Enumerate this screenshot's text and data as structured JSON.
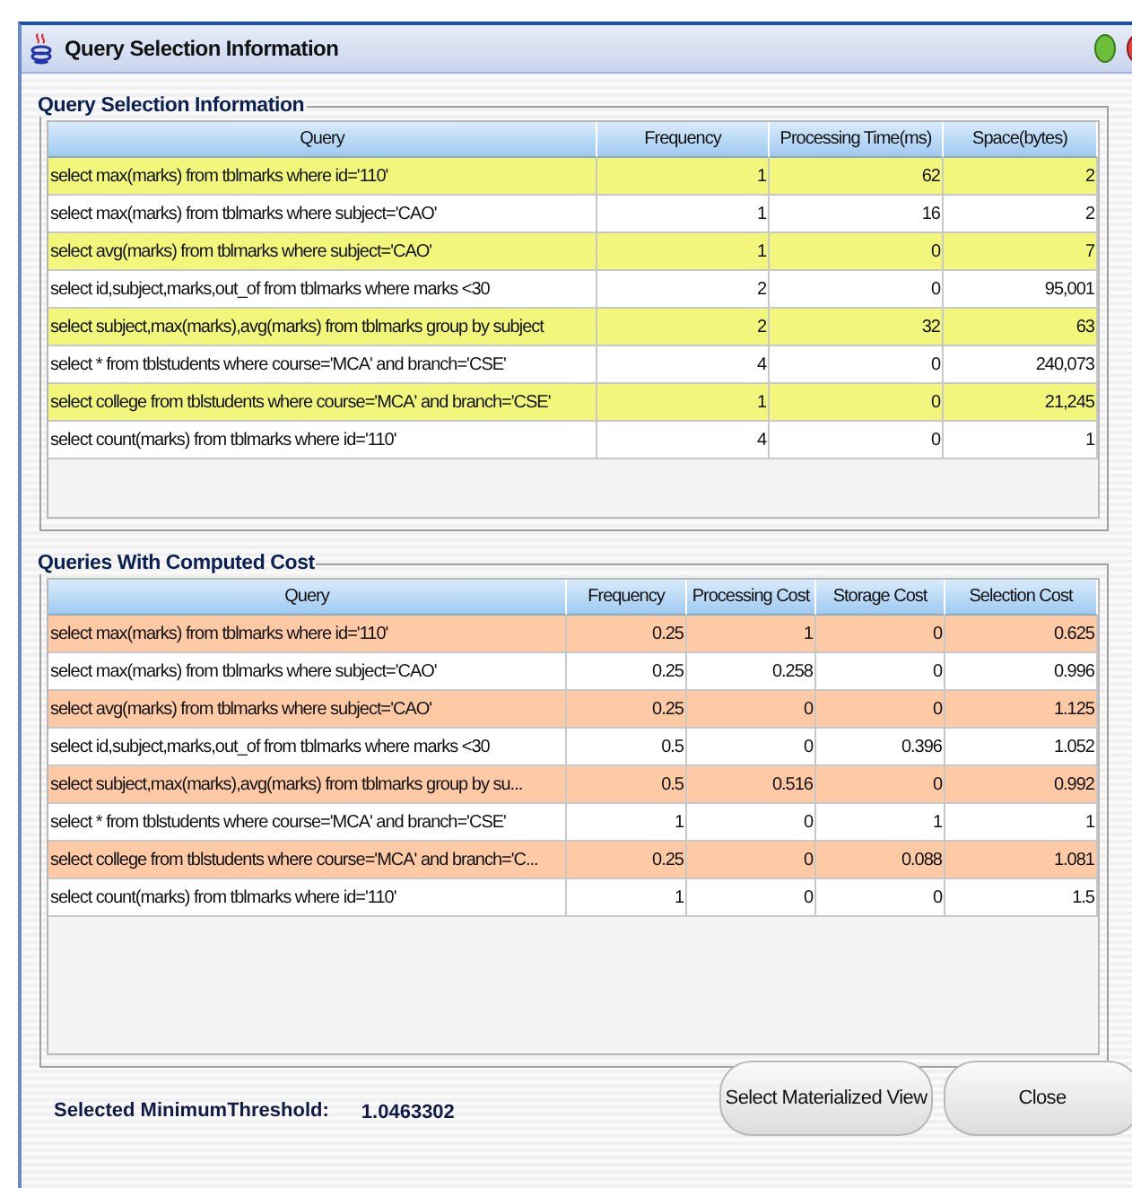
{
  "window": {
    "title": "Query Selection Information"
  },
  "selection_table": {
    "title": "Query Selection Information",
    "columns": [
      "Query",
      "Frequency",
      "Processing Time(ms)",
      "Space(bytes)"
    ],
    "rows": [
      {
        "highlighted": true,
        "cells": [
          "select max(marks) from tblmarks where id='110'",
          "1",
          "62",
          "2"
        ]
      },
      {
        "highlighted": false,
        "cells": [
          "select max(marks) from tblmarks where subject='CAO'",
          "1",
          "16",
          "2"
        ]
      },
      {
        "highlighted": true,
        "cells": [
          "select avg(marks) from tblmarks where subject='CAO'",
          "1",
          "0",
          "7"
        ]
      },
      {
        "highlighted": false,
        "cells": [
          "select id,subject,marks,out_of from tblmarks where marks <30",
          "2",
          "0",
          "95,001"
        ]
      },
      {
        "highlighted": true,
        "cells": [
          "select subject,max(marks),avg(marks) from tblmarks  group by subject",
          "2",
          "32",
          "63"
        ]
      },
      {
        "highlighted": false,
        "cells": [
          "select * from tblstudents where course='MCA' and branch='CSE'",
          "4",
          "0",
          "240,073"
        ]
      },
      {
        "highlighted": true,
        "cells": [
          "select college from tblstudents where course='MCA' and branch='CSE'",
          "1",
          "0",
          "21,245"
        ]
      },
      {
        "highlighted": false,
        "cells": [
          "select count(marks) from tblmarks where id='110'",
          "4",
          "0",
          "1"
        ]
      }
    ]
  },
  "cost_table": {
    "title": "Queries With Computed Cost",
    "columns": [
      "Query",
      "Frequency",
      "Processing Cost",
      "Storage Cost",
      "Selection Cost"
    ],
    "rows": [
      {
        "highlighted": true,
        "cells": [
          "select max(marks) from tblmarks where id='110'",
          "0.25",
          "1",
          "0",
          "0.625"
        ]
      },
      {
        "highlighted": false,
        "cells": [
          "select max(marks) from tblmarks where subject='CAO'",
          "0.25",
          "0.258",
          "0",
          "0.996"
        ]
      },
      {
        "highlighted": true,
        "cells": [
          "select avg(marks) from tblmarks where subject='CAO'",
          "0.25",
          "0",
          "0",
          "1.125"
        ]
      },
      {
        "highlighted": false,
        "cells": [
          "select id,subject,marks,out_of from tblmarks where marks <30",
          "0.5",
          "0",
          "0.396",
          "1.052"
        ]
      },
      {
        "highlighted": true,
        "cells": [
          "select subject,max(marks),avg(marks) from tblmarks  group by su...",
          "0.5",
          "0.516",
          "0",
          "0.992"
        ]
      },
      {
        "highlighted": false,
        "cells": [
          "select * from tblstudents where course='MCA' and branch='CSE'",
          "1",
          "0",
          "1",
          "1"
        ]
      },
      {
        "highlighted": true,
        "cells": [
          "select college from tblstudents where course='MCA' and branch='C...",
          "0.25",
          "0",
          "0.088",
          "1.081"
        ]
      },
      {
        "highlighted": false,
        "cells": [
          "select count(marks) from tblmarks where id='110'",
          "1",
          "0",
          "0",
          "1.5"
        ]
      }
    ]
  },
  "footer": {
    "threshold_label": "Selected MinimumThreshold:",
    "threshold_value": "1.0463302",
    "buttons": [
      "Select Materialized View",
      "Close"
    ]
  }
}
